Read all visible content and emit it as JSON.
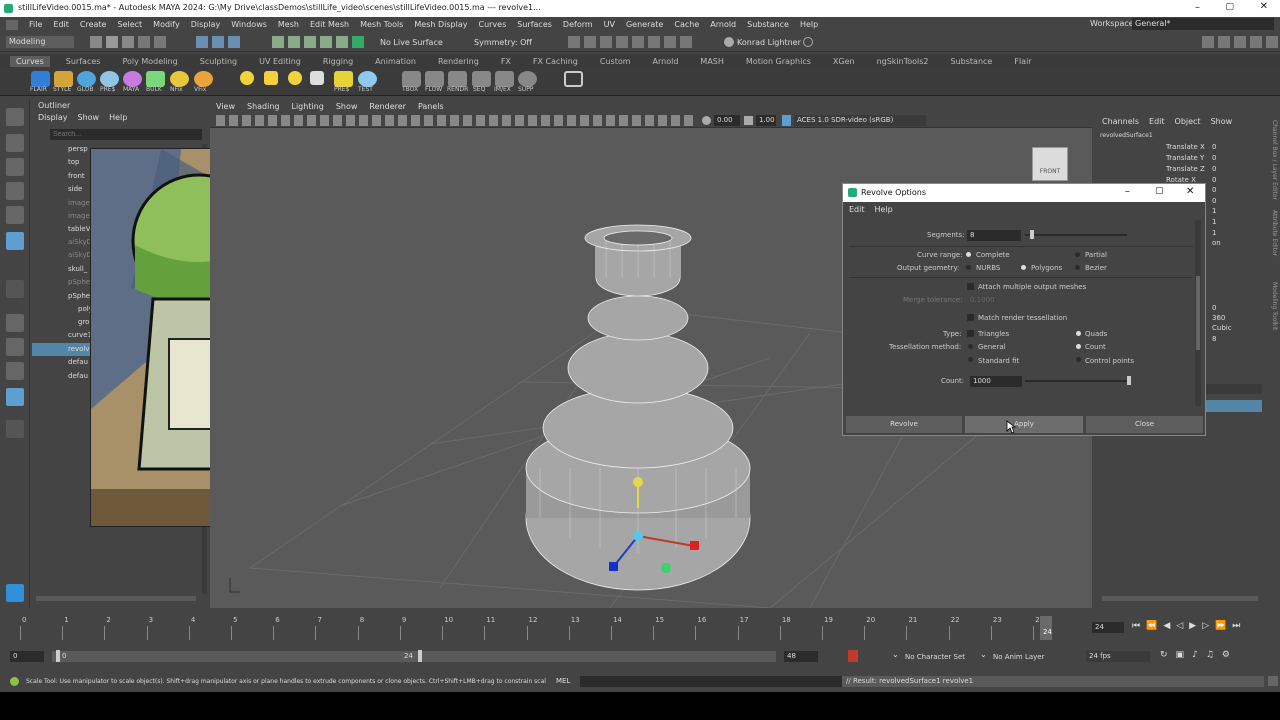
{
  "window": {
    "title": "stillLifeVideo.0015.ma* - Autodesk MAYA 2024: G:\\My Drive\\classDemos\\stillLife_video\\scenes\\stillLifeVideo.0015.ma --- revolve1..."
  },
  "menubar": [
    "File",
    "Edit",
    "Create",
    "Select",
    "Modify",
    "Display",
    "Windows",
    "Mesh",
    "Edit Mesh",
    "Mesh Tools",
    "Mesh Display",
    "Curves",
    "Surfaces",
    "Deform",
    "UV",
    "Generate",
    "Cache",
    "Arnold",
    "Substance",
    "Help"
  ],
  "workspace": {
    "label": "Workspace:",
    "value": "General*"
  },
  "statusline": {
    "mode": "Modeling",
    "live_surface": "No Live Surface",
    "symmetry": "Symmetry: Off",
    "user": "Konrad Lightner"
  },
  "shelf_tabs": [
    "Curves",
    "Surfaces",
    "Poly Modeling",
    "Sculpting",
    "UV Editing",
    "Rigging",
    "Animation",
    "Rendering",
    "FX",
    "FX Caching",
    "Custom",
    "Arnold",
    "MASH",
    "Motion Graphics",
    "XGen",
    "ngSkinTools2",
    "Substance",
    "Flair"
  ],
  "shelf_icons": [
    "FLAIR",
    "STYLE",
    "GLOB",
    "PRE$",
    "MAYA",
    "BULK",
    "NFix",
    "VFix",
    "TBOX",
    "FLOW",
    "RENDR",
    "SEQ",
    "IM/EX",
    "SUPP",
    "TEST"
  ],
  "outliner": {
    "title": "Outliner",
    "menu": [
      "Display",
      "Show",
      "Help"
    ],
    "search_placeholder": "Search...",
    "items": [
      "persp",
      "top",
      "front",
      "side",
      "imageP",
      "imageP",
      "tableV",
      "aiSkyD",
      "aiSkyD",
      "skull_",
      "pSphe",
      "pSphe",
      "poly",
      "grou",
      "curve1",
      "revolv",
      "defau",
      "defau"
    ]
  },
  "viewport": {
    "menu": [
      "View",
      "Shading",
      "Lighting",
      "Show",
      "Renderer",
      "Panels"
    ],
    "exposure": "0.00",
    "gamma": "1.00",
    "colorspace": "ACES 1.0 SDR-video (sRGB)",
    "viewcube_label": "FRONT"
  },
  "channelbox": {
    "menu": [
      "Channels",
      "Edit",
      "Object",
      "Show"
    ],
    "object": "revolvedSurface1",
    "attrs": [
      {
        "name": "Translate X",
        "value": "0"
      },
      {
        "name": "Translate Y",
        "value": "0"
      },
      {
        "name": "Translate Z",
        "value": "0"
      },
      {
        "name": "Rotate X",
        "value": "0"
      }
    ],
    "extra_values": [
      "0",
      "0",
      "1",
      "1",
      "1",
      "on",
      "0",
      "360",
      "Cubic",
      "8"
    ],
    "side_tabs": [
      "Channel Box / Layer Editor",
      "Attribute Editor",
      "Modeling Toolkit"
    ]
  },
  "dialog": {
    "title": "Revolve Options",
    "menu": [
      "Edit",
      "Help"
    ],
    "segments": {
      "label": "Segments:",
      "value": "8"
    },
    "curve_range": {
      "label": "Curve range:",
      "options": [
        "Complete",
        "Partial"
      ],
      "selected": "Complete"
    },
    "output_geometry": {
      "label": "Output geometry:",
      "options": [
        "NURBS",
        "Polygons",
        "Bezier"
      ],
      "selected": "Polygons"
    },
    "attach": "Attach multiple output meshes",
    "merge_tolerance": {
      "label": "Merge tolerance:",
      "value": "0.1000"
    },
    "match_render": "Match render tessellation",
    "type": {
      "label": "Type:",
      "options": [
        "Triangles",
        "Quads"
      ],
      "selected": "Quads"
    },
    "tess_method": {
      "label": "Tessellation method:",
      "options": [
        "General",
        "Count",
        "Standard fit",
        "Control points"
      ],
      "selected": "Count"
    },
    "count": {
      "label": "Count:",
      "value": "1000"
    },
    "buttons": [
      "Revolve",
      "Apply",
      "Close"
    ]
  },
  "timeline": {
    "ticks": [
      "0",
      "1",
      "2",
      "3",
      "4",
      "5",
      "6",
      "7",
      "8",
      "9",
      "10",
      "11",
      "12",
      "13",
      "14",
      "15",
      "16",
      "17",
      "18",
      "19",
      "20",
      "21",
      "22",
      "23",
      "24"
    ],
    "current": "24",
    "current_frame_field": "24"
  },
  "rangebar": {
    "start": "0",
    "inner_start": "0",
    "inner_end": "24",
    "end": "48",
    "character_set": "No Character Set",
    "anim_layer": "No Anim Layer",
    "fps": "24 fps"
  },
  "helpline": {
    "text": "Scale Tool: Use manipulator to scale object(s). Shift+drag manipulator axis or plane handles to extrude components or clone objects. Ctrl+Shift+LMB+drag to constrain scaling to",
    "mel": "MEL",
    "result": "// Result: revolvedSurface1 revolve1"
  },
  "colors": {
    "accent": "#5d9fd0",
    "selected_row": "#5285a6",
    "panel": "#444444",
    "viewport": "#5a5a5a"
  }
}
